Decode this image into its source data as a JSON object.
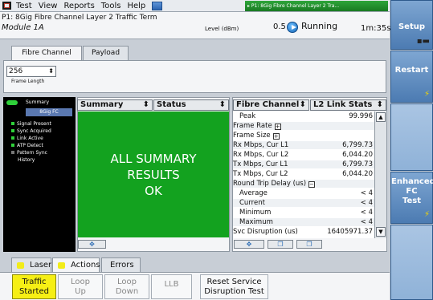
{
  "menubar": {
    "items": [
      "Test",
      "View",
      "Reports",
      "Tools",
      "Help"
    ]
  },
  "test_tab": "P1: 8Gig Fibre Channel Layer 2 Tra...",
  "header": {
    "title": "P1: 8Gig Fibre Channel Layer 2 Traffic Term",
    "module": "Module 1A",
    "level_label": "Level (dBm)",
    "level_value": "0.5",
    "status": "Running",
    "elapsed": "1m:35s"
  },
  "side_buttons": {
    "setup": "Setup",
    "restart": "Restart",
    "enhanced": [
      "Enhanced",
      "FC",
      "Test"
    ]
  },
  "subtabs": [
    "Fibre Channel",
    "Payload"
  ],
  "frame_length": {
    "value": "256",
    "label": "Frame Length"
  },
  "status_panel": {
    "summary": "Summary",
    "fc_label": "8Gig FC",
    "signals": [
      "Signal Present",
      "Sync Acquired",
      "Link Active",
      "ATP Detect",
      "Pattern Sync",
      "History"
    ]
  },
  "summary_panel": {
    "sel1": "Summary",
    "sel2": "Status",
    "lines": [
      "ALL SUMMARY",
      "RESULTS",
      "OK"
    ]
  },
  "stats_panel": {
    "sel1": "Fibre Channel",
    "sel2": "L2 Link Stats",
    "rows": [
      {
        "k": "Peak",
        "v": "99.996",
        "indent": true
      },
      {
        "k": "Frame Rate",
        "v": "",
        "toggle": "+"
      },
      {
        "k": "Frame Size",
        "v": "",
        "toggle": "+"
      },
      {
        "k": "Rx Mbps, Cur L1",
        "v": "6,799.73"
      },
      {
        "k": "Rx Mbps, Cur L2",
        "v": "6,044.20"
      },
      {
        "k": "Tx Mbps, Cur L1",
        "v": "6,799.73"
      },
      {
        "k": "Tx Mbps, Cur L2",
        "v": "6,044.20"
      },
      {
        "k": "Round Trip Delay (us)",
        "v": "",
        "toggle": "−"
      },
      {
        "k": "Average",
        "v": "< 4",
        "indent": true
      },
      {
        "k": "Current",
        "v": "< 4",
        "indent": true
      },
      {
        "k": "Minimum",
        "v": "< 4",
        "indent": true
      },
      {
        "k": "Maximum",
        "v": "< 4",
        "indent": true
      },
      {
        "k": "Svc Disruption (us)",
        "v": "16405971.37"
      }
    ]
  },
  "bottom_tabs": [
    "Laser",
    "Actions",
    "Errors"
  ],
  "actions": {
    "traffic": [
      "Traffic",
      "Started"
    ],
    "loop_up": [
      "Loop",
      "Up"
    ],
    "loop_down": [
      "Loop",
      "Down"
    ],
    "llb": "LLB",
    "reset": [
      "Reset Service",
      "Disruption Test"
    ]
  }
}
